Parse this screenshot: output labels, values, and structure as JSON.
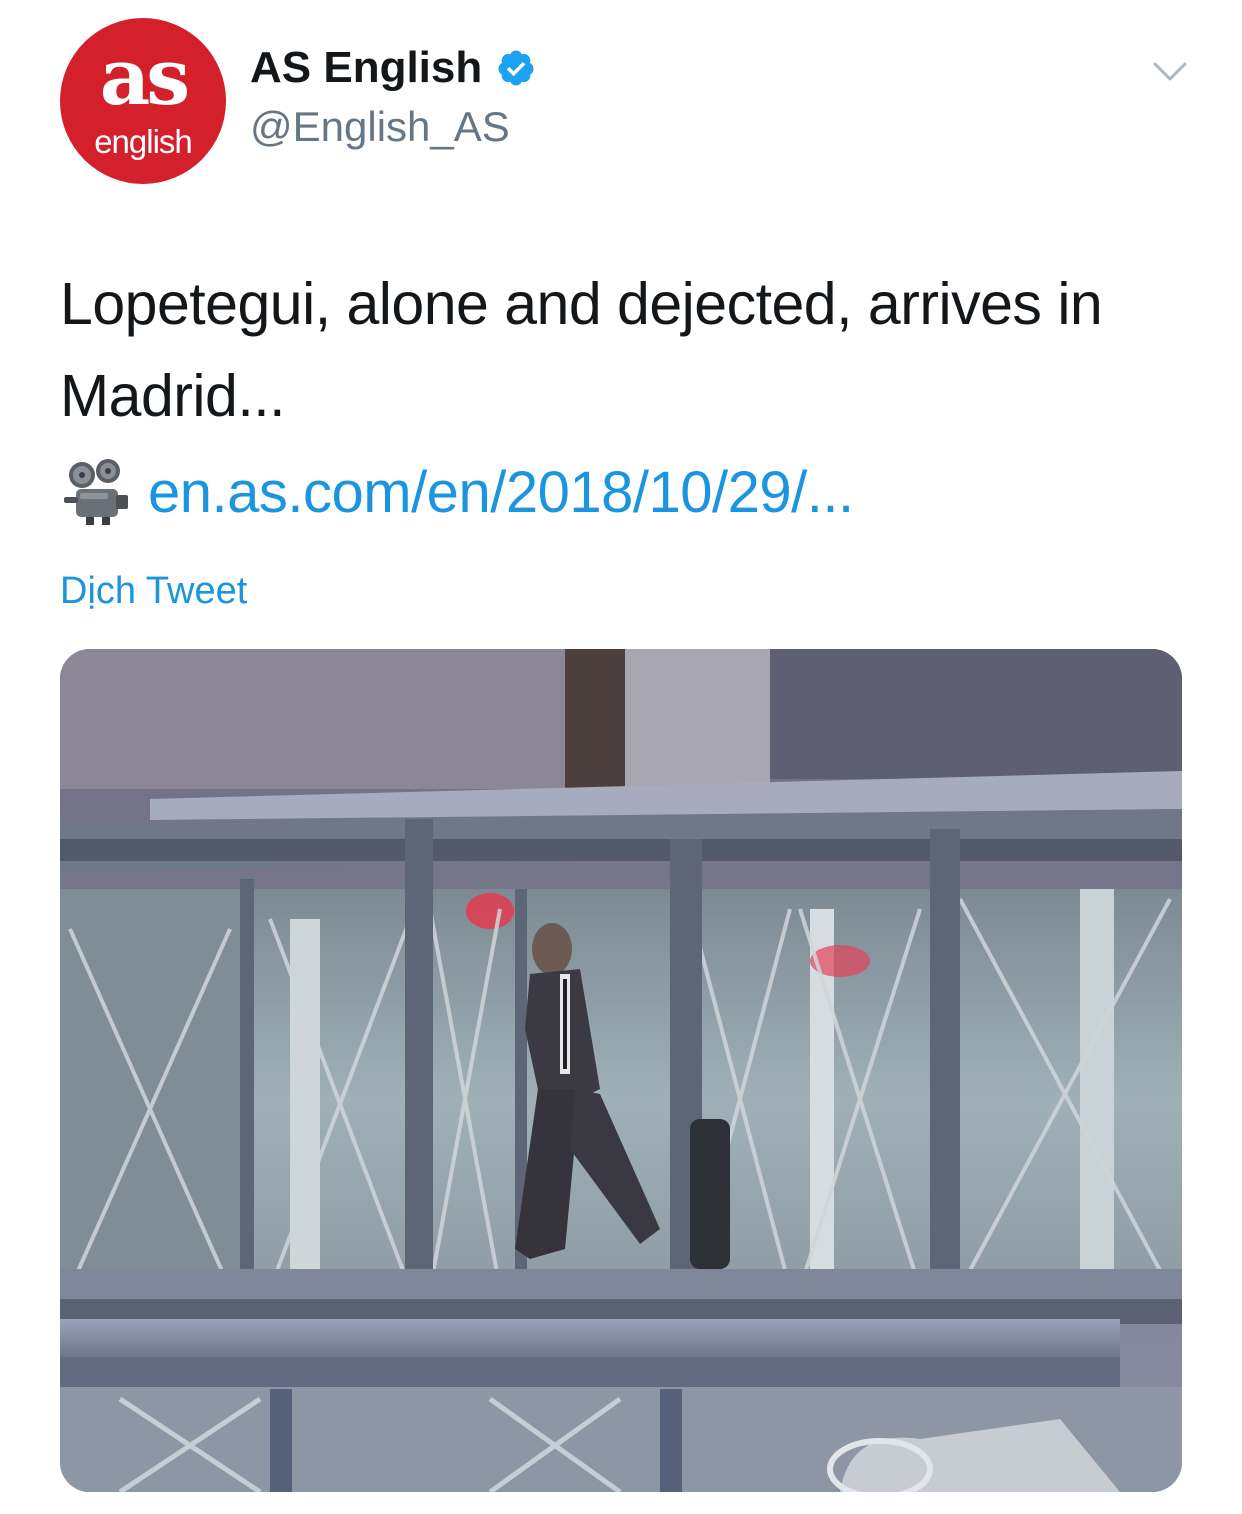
{
  "author": {
    "avatar_text_top": "as",
    "avatar_text_bottom": "english",
    "display_name": "AS English",
    "handle": "@English_AS",
    "brand_color": "#d4202a",
    "verified": true,
    "verified_icon": "verified-badge-icon",
    "verified_color": "#1da1f2"
  },
  "menu_icon": "chevron-down-icon",
  "tweet": {
    "text": "Lopetegui, alone and dejected, arrives in Madrid...",
    "link_emoji": "film-projector-icon",
    "link_text": "en.as.com/en/2018/10/29/...",
    "link_color": "#1b95e0",
    "translate_label": "Dịch Tweet"
  },
  "media": {
    "type": "photo"
  }
}
